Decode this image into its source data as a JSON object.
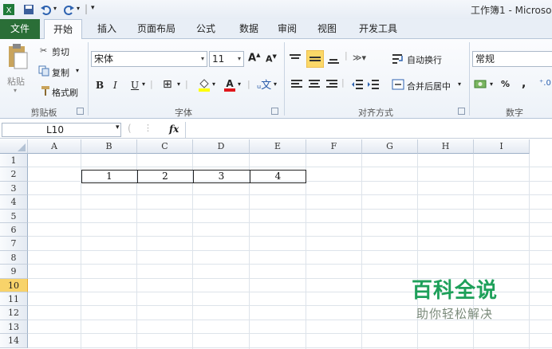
{
  "window": {
    "title": "工作簿1 - Microso"
  },
  "tabs": [
    "文件",
    "开始",
    "插入",
    "页面布局",
    "公式",
    "数据",
    "审阅",
    "视图",
    "开发工具"
  ],
  "ribbon": {
    "clipboard": {
      "paste": "粘贴",
      "cut": "剪切",
      "copy": "复制",
      "format_painter": "格式刷",
      "label": "剪贴板"
    },
    "font": {
      "name": "宋体",
      "size": "11",
      "bold": "B",
      "italic": "I",
      "underline": "U",
      "label": "字体"
    },
    "alignment": {
      "wrap": "自动换行",
      "merge": "合并后居中",
      "label": "对齐方式"
    },
    "number": {
      "format": "常规",
      "percent": "%",
      "comma": ",",
      "label": "数字"
    }
  },
  "formula_bar": {
    "name_box": "L10",
    "fx": "fx",
    "value": ""
  },
  "sheet": {
    "columns": [
      "A",
      "B",
      "C",
      "D",
      "E",
      "F",
      "G",
      "H",
      "I"
    ],
    "rows": [
      "1",
      "2",
      "3",
      "4",
      "5",
      "6",
      "7",
      "8",
      "9",
      "10",
      "11",
      "12",
      "13",
      "14"
    ],
    "selected_row": "10",
    "cells": {
      "B2": "1",
      "C2": "2",
      "D2": "3",
      "E2": "4"
    }
  },
  "watermark": {
    "title": "百科全说",
    "subtitle": "助你轻松解决"
  },
  "colors": {
    "file_tab": "#2a6e37",
    "selected_row": "#f8d36a",
    "watermark": "#1ea05a"
  }
}
